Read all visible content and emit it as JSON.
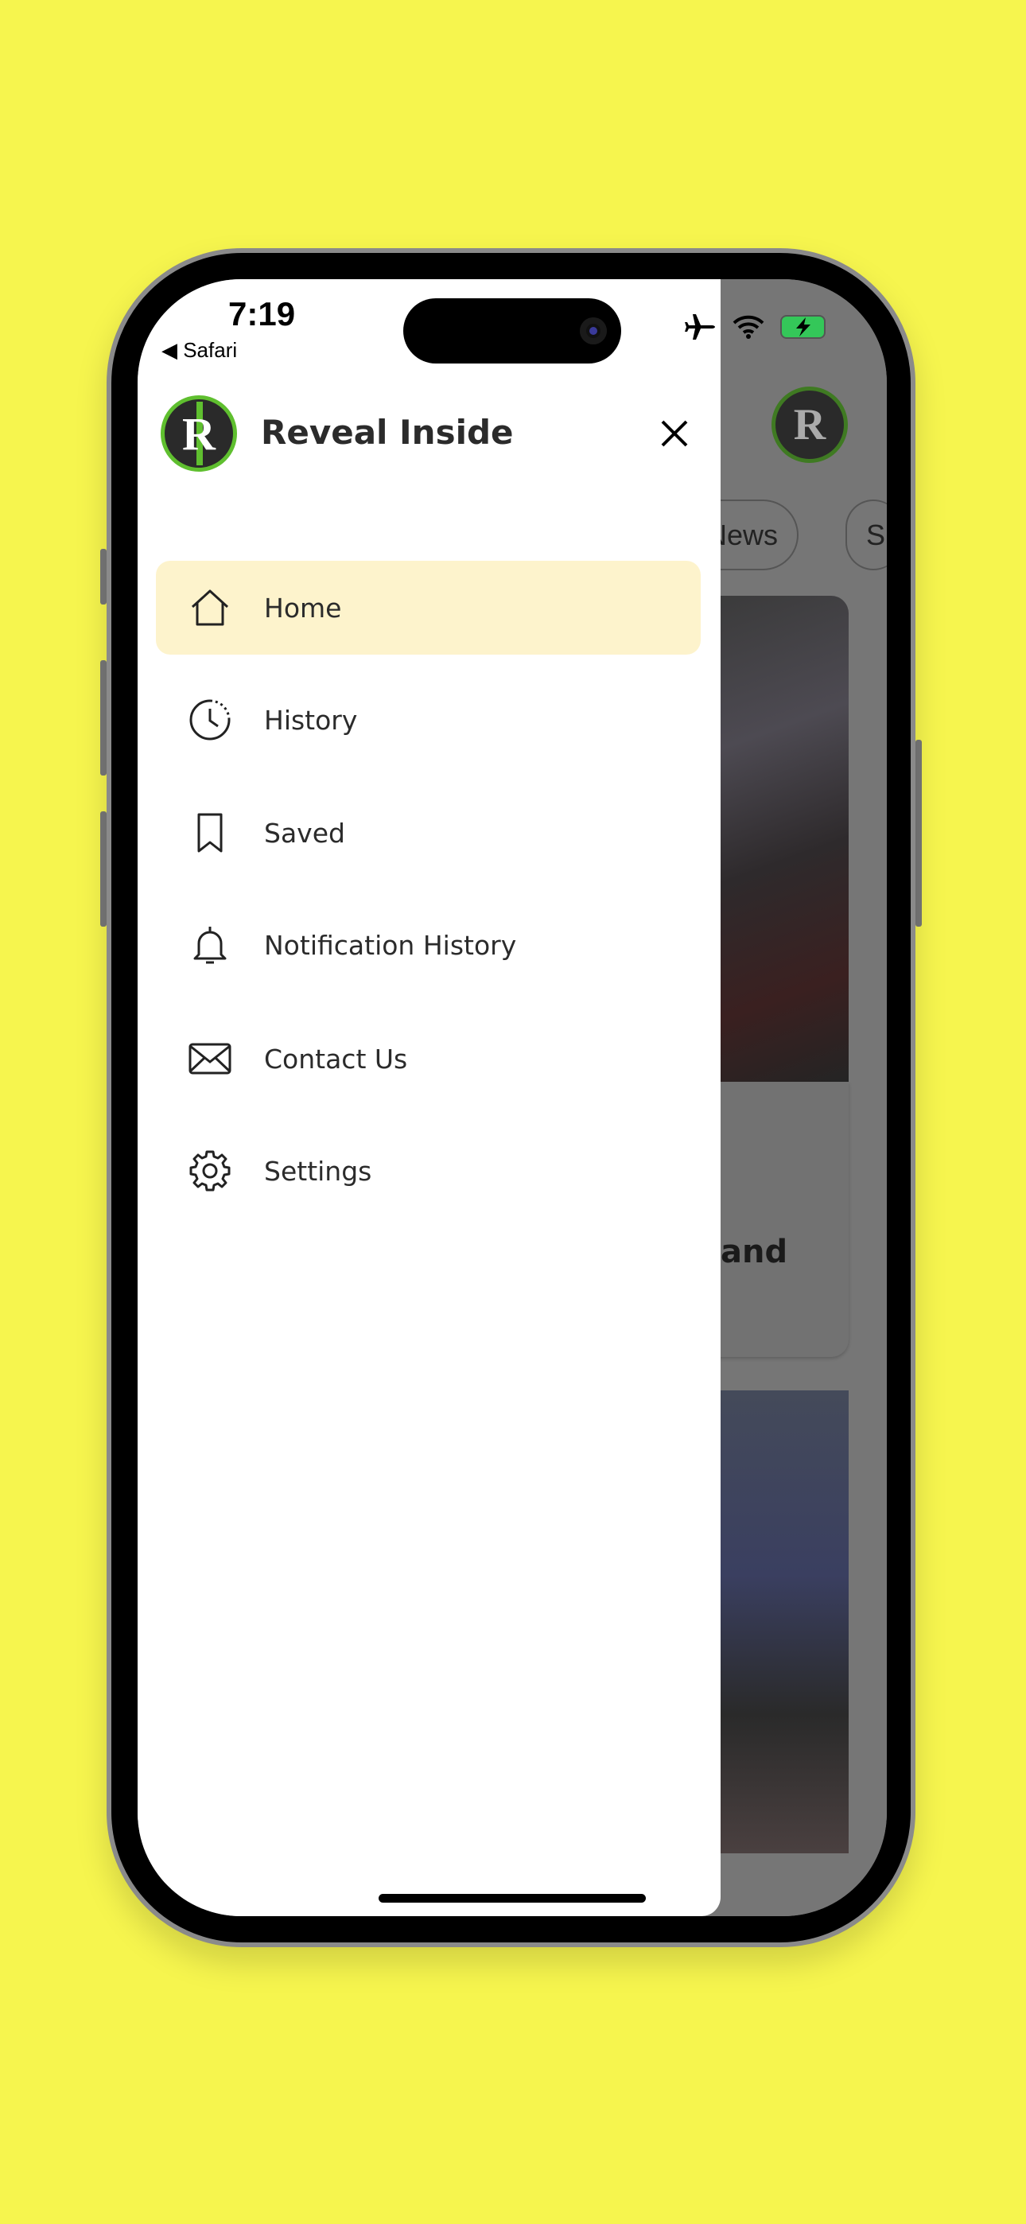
{
  "status_bar": {
    "time": "7:19",
    "back_label": "Safari",
    "icons": [
      "airplane-icon",
      "wifi-icon",
      "battery-charging-icon"
    ],
    "battery_color": "#34c759"
  },
  "drawer": {
    "title": "Reveal Inside",
    "logo_text": "R",
    "close_icon": "close-icon",
    "items": [
      {
        "label": "Home",
        "icon": "home-icon",
        "active": true
      },
      {
        "label": "History",
        "icon": "history-icon"
      },
      {
        "label": "Saved",
        "icon": "bookmark-icon"
      },
      {
        "label": "Notification History",
        "icon": "bell-icon"
      },
      {
        "label": "Contact Us",
        "icon": "mail-icon"
      },
      {
        "label": "Settings",
        "icon": "gear-icon"
      }
    ],
    "active_color": "#fdf3cc"
  },
  "background": {
    "chips": [
      "News",
      "Sp"
    ],
    "card_text": "and",
    "logo_text": "R"
  },
  "colors": {
    "page": "#f6f54e",
    "logo_green": "#5fbf2f"
  }
}
